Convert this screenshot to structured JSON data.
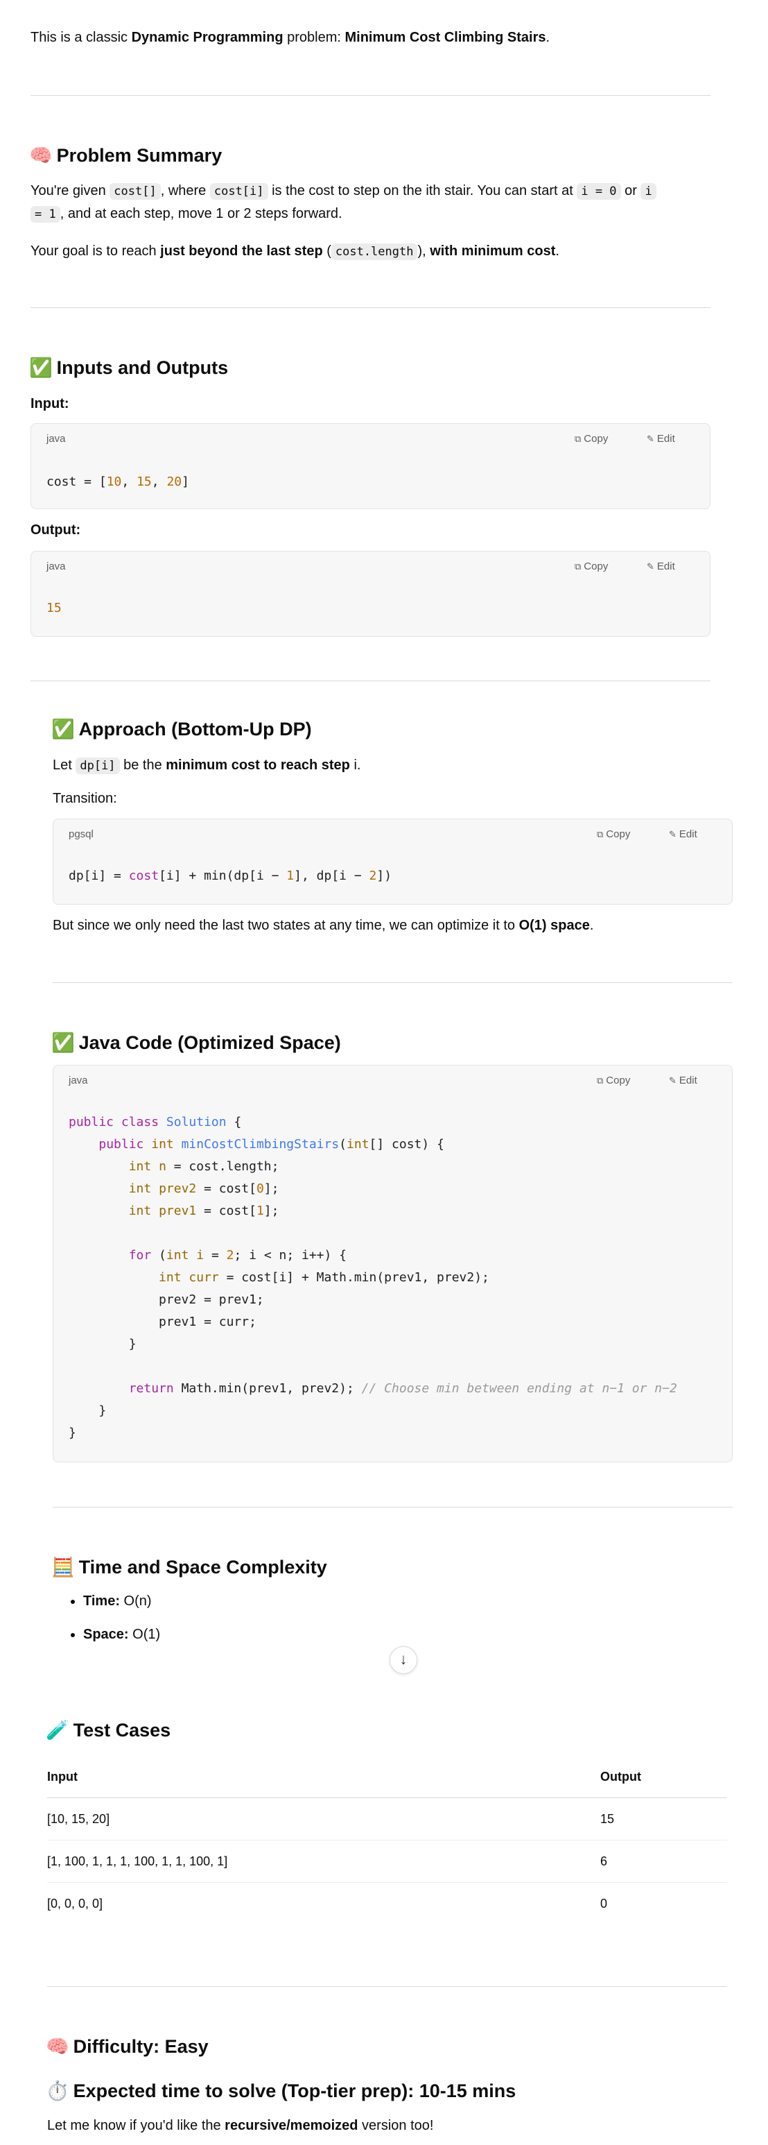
{
  "intro": {
    "prefix": "This is a classic ",
    "bold1": "Dynamic Programming",
    "mid": " problem: ",
    "bold2": "Minimum Cost Climbing Stairs",
    "suffix": "."
  },
  "summary": {
    "emoji": "🧠",
    "title": "Problem Summary",
    "p1_a": "You're given ",
    "p1_code1": "cost[]",
    "p1_b": ", where ",
    "p1_code2": "cost[i]",
    "p1_c": " is the cost to step on the ith stair. You can start at ",
    "p1_code3": "i = 0",
    "p1_d": " or ",
    "p1_code4a": "i",
    "p1_code4b": "= 1",
    "p1_e": ", and at each step, move 1 or 2 steps forward.",
    "p2_a": "Your goal is to reach ",
    "p2_bold1": "just beyond the last step",
    "p2_b": " (",
    "p2_code": "cost.length",
    "p2_c": "), ",
    "p2_bold2": "with minimum cost",
    "p2_d": "."
  },
  "io": {
    "emoji": "✅",
    "title": "Inputs and Outputs",
    "input_label": "Input:",
    "output_label": "Output:",
    "input_lang": "java",
    "output_lang": "java",
    "input_code_a": "cost = [",
    "input_n1": "10",
    "input_sep1": ", ",
    "input_n2": "15",
    "input_sep2": ", ",
    "input_n3": "20",
    "input_code_b": "]",
    "output_value": "15"
  },
  "code_actions": {
    "copy": "Copy",
    "edit": "Edit"
  },
  "approach": {
    "emoji": "✅",
    "title": "Approach (Bottom-Up DP)",
    "p1_a": "Let ",
    "p1_code": "dp[i]",
    "p1_b": " be the ",
    "p1_bold": "minimum cost to reach step",
    "p1_c": " i.",
    "transition_label": "Transition:",
    "lang": "pgsql",
    "p2_a": "But since we only need the last two states at any time, we can optimize it to ",
    "p2_bold": "O(1) space",
    "p2_b": "."
  },
  "javacode": {
    "emoji": "✅",
    "title": "Java Code (Optimized Space)",
    "lang": "java",
    "comment": "// Choose min between ending at n−1 or n−2"
  },
  "complexity": {
    "emoji": "🧮",
    "title": "Time and Space Complexity",
    "time_label": "Time:",
    "time_value": " O(n)",
    "space_label": "Space:",
    "space_value": " O(1)"
  },
  "tests": {
    "emoji": "🧪",
    "title": "Test Cases",
    "headers": [
      "Input",
      "Output"
    ],
    "rows": [
      {
        "input": "[10, 15, 20]",
        "output": "15"
      },
      {
        "input": "[1, 100, 1, 1, 1, 100, 1, 1, 100, 1]",
        "output": "6"
      },
      {
        "input": "[0, 0, 0, 0]",
        "output": "0"
      }
    ]
  },
  "difficulty": {
    "emoji": "🧠",
    "title": "Difficulty: Easy"
  },
  "expected": {
    "emoji": "⏱️",
    "title": "Expected time to solve (Top-tier prep): 10-15 mins"
  },
  "closing": {
    "a": "Let me know if you'd like the ",
    "bold": "recursive/memoized",
    "b": " version too!"
  },
  "icons": {
    "copy": "copy-icon",
    "edit": "edit-icon",
    "scroll": "arrow-down-icon"
  }
}
